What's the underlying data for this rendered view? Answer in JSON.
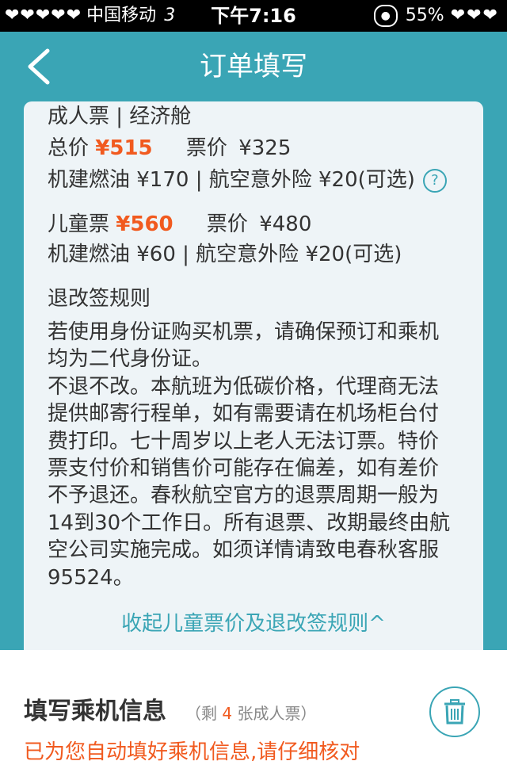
{
  "status_bar": {
    "signal": "❤❤❤❤❤",
    "carrier": "中国移动",
    "network": "3",
    "time": "下午7:16",
    "battery_percent": "55%",
    "battery_icons": "❤❤❤"
  },
  "nav": {
    "title": "订单填写",
    "back_icon": "chevron-left-icon",
    "color": "#3aa5b5"
  },
  "fare": {
    "adult": {
      "header": "成人票 | 经济舱",
      "total_label": "总价",
      "total_price": "¥515",
      "ticket_price_label": "票价",
      "ticket_price": "¥325",
      "fees": "机建燃油 ¥170 | 航空意外险 ¥20(可选)",
      "help_icon": "?"
    },
    "child": {
      "label": "儿童票",
      "price": "¥560",
      "ticket_price_label": "票价",
      "ticket_price": "¥480",
      "fees": "机建燃油 ¥60 | 航空意外险 ¥20(可选)"
    }
  },
  "rules": {
    "heading": "退改签规则",
    "paragraphs": [
      "若使用身份证购买机票，请确保预订和乘机均为二代身份证。",
      "不退不改。本航班为低碳价格，代理商无法提供邮寄行程单，如有需要请在机场柜台付费打印。七十周岁以上老人无法订票。特价票支付价和销售价可能存在偏差，如有差价不予退还。春秋航空官方的退票周期一般为14到30个工作日。所有退票、改期最终由航空公司实施完成。如须详情请致电春秋客服95524。"
    ],
    "collapse_link": "收起儿童票价及退改签规则^"
  },
  "passenger": {
    "title": "填写乘机信息",
    "remaining_prefix": "（剩",
    "remaining_count": "4",
    "remaining_suffix": "张成人票）",
    "delete_icon": "trash-icon",
    "autofill_note": "已为您自动填好乘机信息,请仔细核对"
  },
  "colors": {
    "accent": "#3aa5b5",
    "price": "#f15a1f",
    "card_bg": "#eef4f7"
  }
}
